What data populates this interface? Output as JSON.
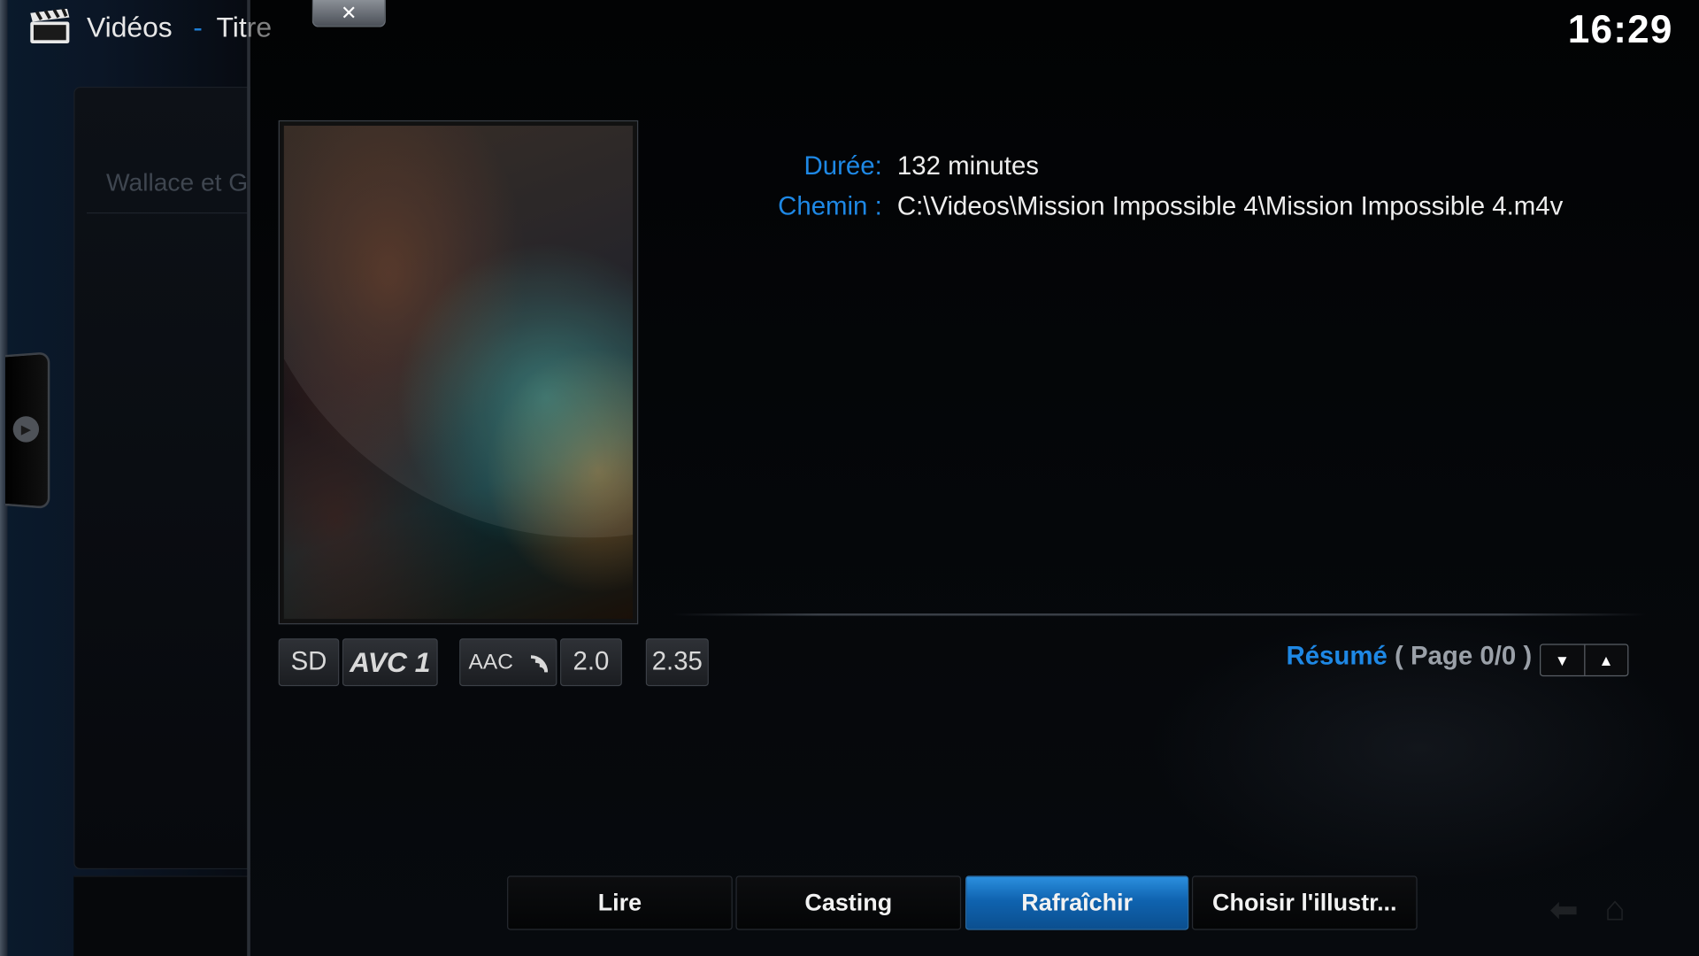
{
  "header": {
    "section": "Vidéos",
    "separator": "-",
    "subsection": "Tit",
    "subsection_tail": "re",
    "clock": "16:29"
  },
  "background": {
    "list_item": "Wallace et G"
  },
  "info": {
    "duration_label": "Durée:",
    "duration_value": "132 minutes",
    "path_label": "Chemin :",
    "path_value": "C:\\Videos\\Mission Impossible 4\\Mission Impossible 4.m4v"
  },
  "flags": {
    "resolution": "SD",
    "video_codec": "AVC 1",
    "audio_codec": "AAC",
    "audio_channels": "2.0",
    "aspect": "2.35"
  },
  "summary": {
    "label": "Résumé",
    "page": "( Page 0/0 )"
  },
  "buttons": {
    "play": "Lire",
    "cast": "Casting",
    "refresh": "Rafraîchir",
    "choose_art": "Choisir l'illustr..."
  },
  "icons": {
    "close": "close-icon",
    "header": "clapperboard-icon",
    "pager_down": "arrow-down-icon",
    "pager_up": "arrow-up-icon"
  },
  "colors": {
    "accent": "#1e88e5",
    "focus_button": "#1a75c6"
  }
}
